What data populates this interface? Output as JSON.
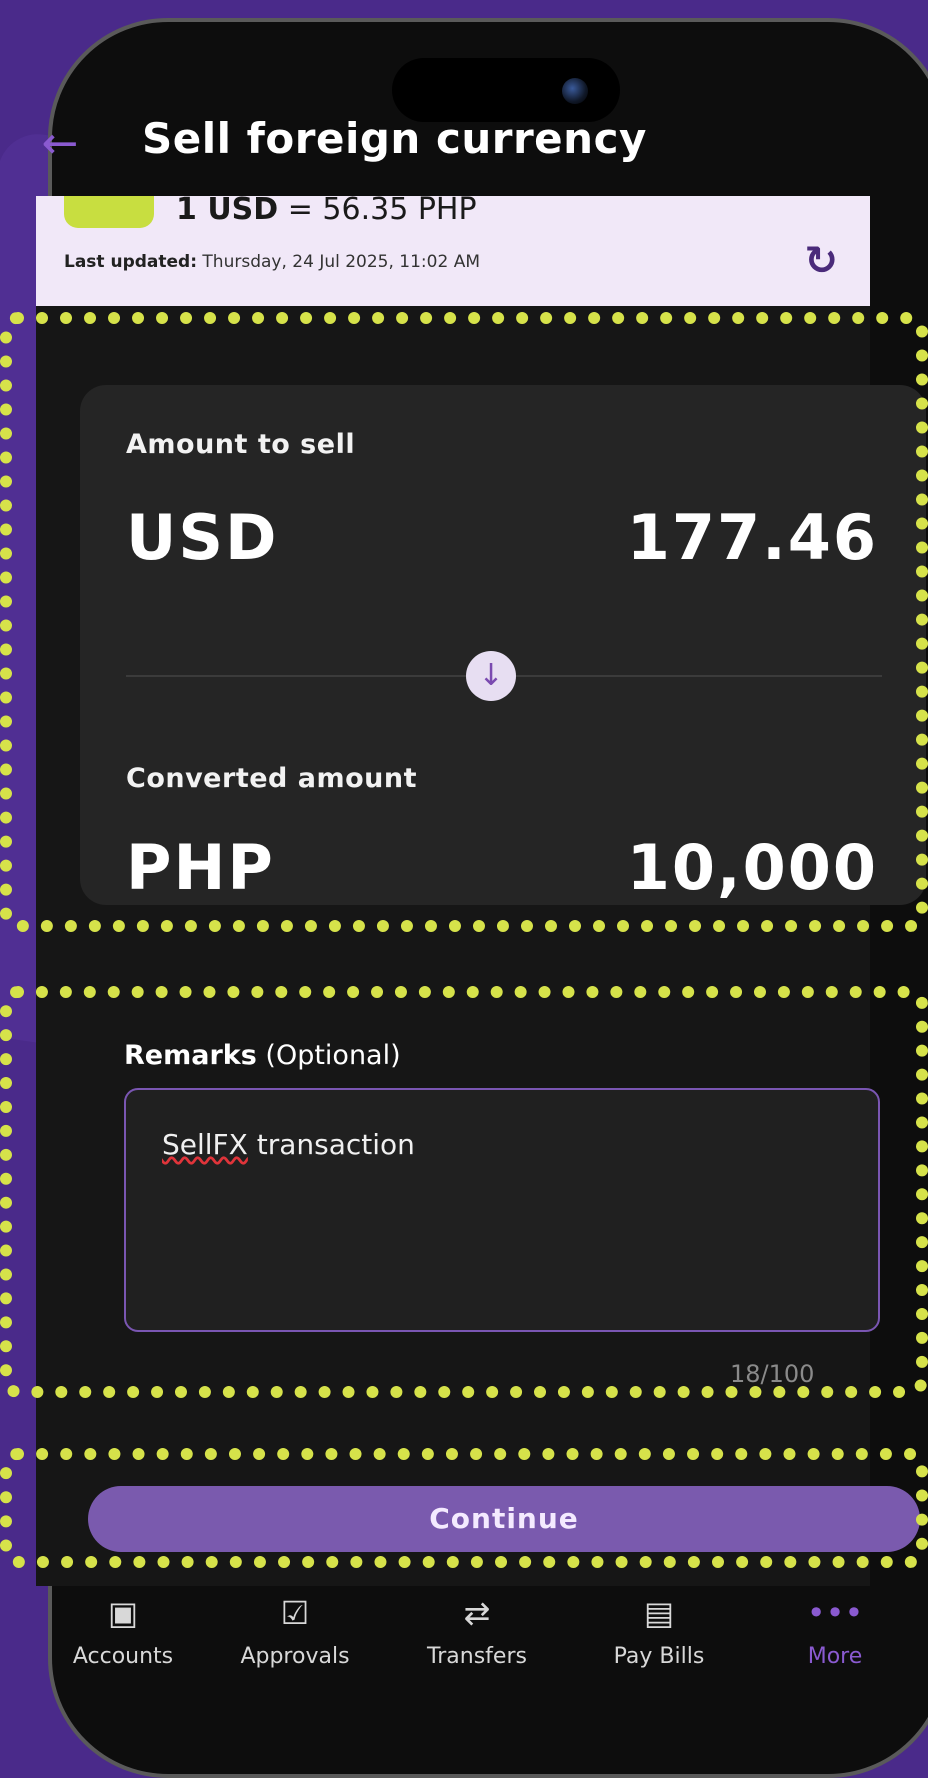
{
  "header": {
    "title": "Sell foreign currency"
  },
  "rate": {
    "base": "1 USD",
    "equals": "= 56.35 PHP",
    "updated_label": "Last updated:",
    "updated_value": "Thursday, 24 Jul 2025, 11:02 AM"
  },
  "sell": {
    "label": "Amount to sell",
    "currency": "USD",
    "amount": "177.46"
  },
  "converted": {
    "label": "Converted amount",
    "currency": "PHP",
    "amount": "10,000"
  },
  "remarks": {
    "label": "Remarks",
    "optional": "(Optional)",
    "value_word1": "SellFX",
    "value_rest": " transaction",
    "counter": "18/100"
  },
  "continue_label": "Continue",
  "nav": [
    {
      "label": "Accounts",
      "icon": "accounts-icon"
    },
    {
      "label": "Approvals",
      "icon": "approvals-icon"
    },
    {
      "label": "Transfers",
      "icon": "transfers-icon"
    },
    {
      "label": "Pay Bills",
      "icon": "pay-bills-icon"
    },
    {
      "label": "More",
      "icon": "more-icon",
      "active": true
    }
  ],
  "colors": {
    "background": "#4a2a8a",
    "accent": "#7a5aae",
    "highlight": "#d6e24a",
    "rate_panel": "#f1e8f8"
  }
}
